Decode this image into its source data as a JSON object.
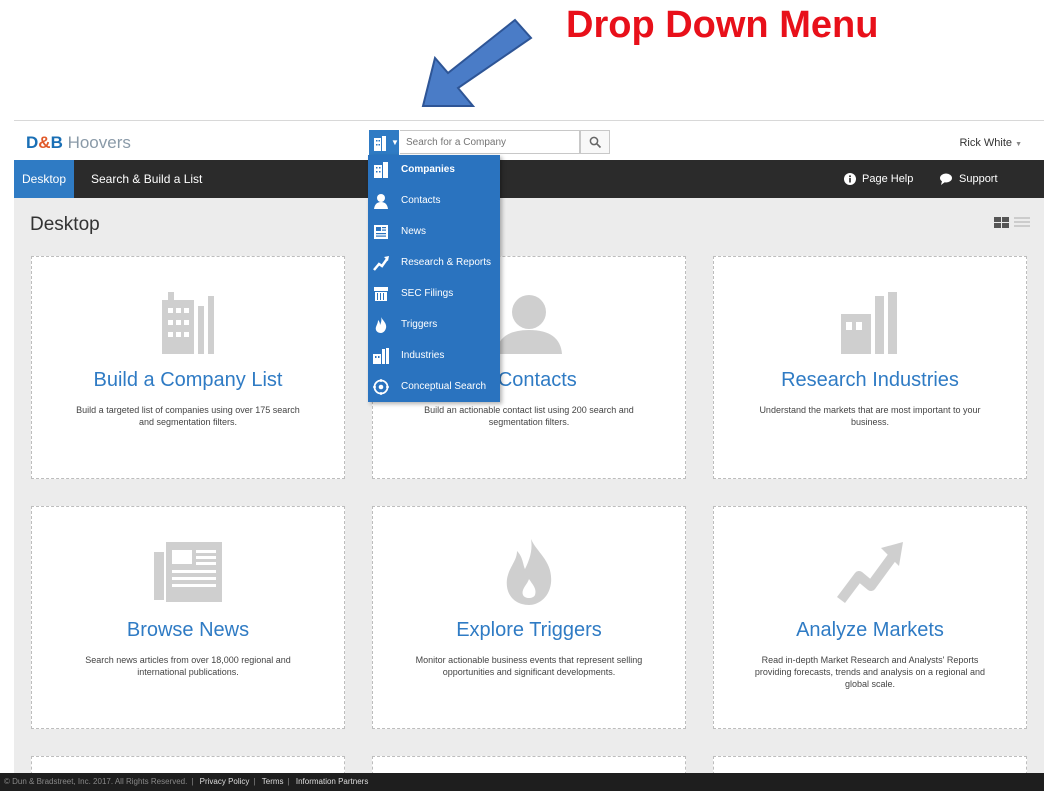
{
  "annotation": {
    "callout": "Drop Down Menu"
  },
  "header": {
    "logo_db": "D",
    "logo_amp": "&",
    "logo_b": "B",
    "logo_name": " Hoovers",
    "search_placeholder": "Search for a Company",
    "user_name": "Rick White"
  },
  "nav": {
    "tabs": [
      {
        "label": "Desktop"
      },
      {
        "label": "Search & Build a List"
      }
    ],
    "page_help": "Page Help",
    "support": "Support"
  },
  "page": {
    "title": "Desktop"
  },
  "dropdown": {
    "items": [
      {
        "label": "Companies",
        "icon": "building-icon"
      },
      {
        "label": "Contacts",
        "icon": "person-icon"
      },
      {
        "label": "News",
        "icon": "newspaper-icon"
      },
      {
        "label": "Research & Reports",
        "icon": "trend-icon"
      },
      {
        "label": "SEC Filings",
        "icon": "filings-icon"
      },
      {
        "label": "Triggers",
        "icon": "flame-icon"
      },
      {
        "label": "Industries",
        "icon": "factory-icon"
      },
      {
        "label": "Conceptual Search",
        "icon": "target-icon"
      }
    ]
  },
  "cards": [
    {
      "title": "Build a Company List",
      "desc": "Build a targeted list of companies using over 175 search and segmentation filters."
    },
    {
      "title": "d Contacts",
      "desc": "Build an actionable contact list using 200 search and segmentation filters."
    },
    {
      "title": "Research Industries",
      "desc": "Understand the markets that are most important to your business."
    },
    {
      "title": "Browse News",
      "desc": "Search news articles from over 18,000 regional and international publications."
    },
    {
      "title": "Explore Triggers",
      "desc": "Monitor actionable business events that represent selling opportunities and significant developments."
    },
    {
      "title": "Analyze Markets",
      "desc": "Read in-depth Market Research and Analysts' Reports providing forecasts, trends and analysis on a regional and global scale."
    }
  ],
  "footer": {
    "copyright": "© Dun & Bradstreet, Inc. 2017. All Rights Reserved.",
    "privacy": "Privacy Policy",
    "terms": "Terms",
    "partners": "Information Partners"
  }
}
